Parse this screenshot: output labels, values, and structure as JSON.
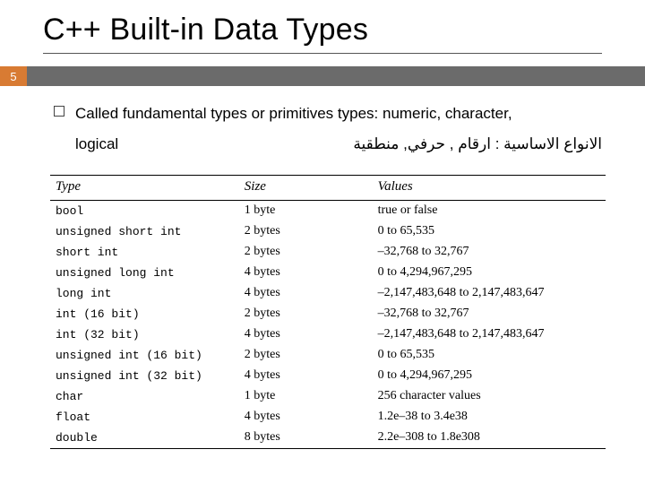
{
  "title": "C++ Built-in Data Types",
  "page_number": "5",
  "bullet": {
    "line1": "Called fundamental types or primitives types: numeric, character,",
    "line2_left": "logical",
    "line2_right": "الانواع الاساسية : ارقام , حرفي, منطقية"
  },
  "table": {
    "headers": {
      "type": "Type",
      "size": "Size",
      "values": "Values"
    },
    "rows": [
      {
        "type": "bool",
        "size": "1 byte",
        "values": "true or false"
      },
      {
        "type": "unsigned short int",
        "size": "2 bytes",
        "values": "0 to 65,535"
      },
      {
        "type": "short int",
        "size": "2 bytes",
        "values": "–32,768 to 32,767"
      },
      {
        "type": "unsigned long int",
        "size": "4 bytes",
        "values": "0 to 4,294,967,295"
      },
      {
        "type": "long int",
        "size": "4 bytes",
        "values": "–2,147,483,648 to 2,147,483,647"
      },
      {
        "type": "int (16 bit)",
        "size": "2 bytes",
        "values": "–32,768 to 32,767"
      },
      {
        "type": "int (32 bit)",
        "size": "4 bytes",
        "values": "–2,147,483,648 to 2,147,483,647"
      },
      {
        "type": "unsigned int (16 bit)",
        "size": "2 bytes",
        "values": "0 to 65,535"
      },
      {
        "type": "unsigned int (32 bit)",
        "size": "4 bytes",
        "values": "0 to 4,294,967,295"
      },
      {
        "type": "char",
        "size": "1 byte",
        "values": "256 character values"
      },
      {
        "type": "float",
        "size": "4 bytes",
        "values": "1.2e–38 to 3.4e38"
      },
      {
        "type": "double",
        "size": "8 bytes",
        "values": "2.2e–308 to 1.8e308"
      }
    ]
  }
}
